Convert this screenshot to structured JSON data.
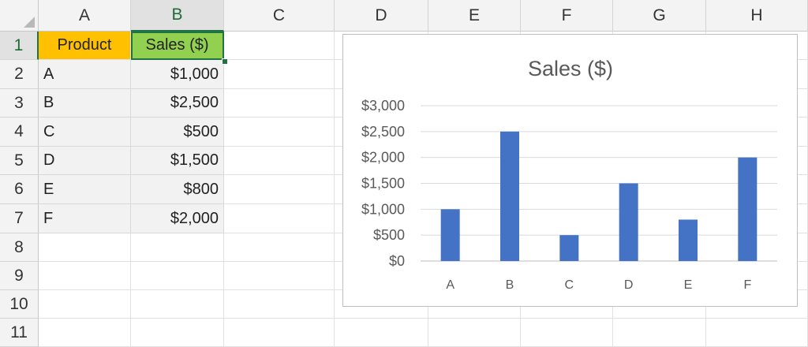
{
  "sheet": {
    "columns": [
      "A",
      "B",
      "C",
      "D",
      "E",
      "F",
      "G",
      "H"
    ],
    "rows": [
      "1",
      "2",
      "3",
      "4",
      "5",
      "6",
      "7",
      "8",
      "9",
      "10",
      "11"
    ],
    "selected_column": "B",
    "selected_row": "1",
    "header": {
      "product": "Product",
      "sales": "Sales ($)"
    },
    "data_rows": [
      {
        "product": "A",
        "sales": "$1,000"
      },
      {
        "product": "B",
        "sales": "$2,500"
      },
      {
        "product": "C",
        "sales": "$500"
      },
      {
        "product": "D",
        "sales": "$1,500"
      },
      {
        "product": "E",
        "sales": "$800"
      },
      {
        "product": "F",
        "sales": "$2,000"
      }
    ],
    "colors": {
      "product_header_fill": "#ffc000",
      "sales_header_fill": "#92d050",
      "selection": "#217346"
    }
  },
  "chart_data": {
    "type": "bar",
    "title": "Sales ($)",
    "categories": [
      "A",
      "B",
      "C",
      "D",
      "E",
      "F"
    ],
    "values": [
      1000,
      2500,
      500,
      1500,
      800,
      2000
    ],
    "ylim": [
      0,
      3000
    ],
    "yticks": [
      0,
      500,
      1000,
      1500,
      2000,
      2500,
      3000
    ],
    "ytick_labels": [
      "$0",
      "$500",
      "$1,000",
      "$1,500",
      "$2,000",
      "$2,500",
      "$3,000"
    ],
    "xlabel": "",
    "ylabel": "",
    "grid": true,
    "legend": "none",
    "bar_color": "#4472c4"
  }
}
